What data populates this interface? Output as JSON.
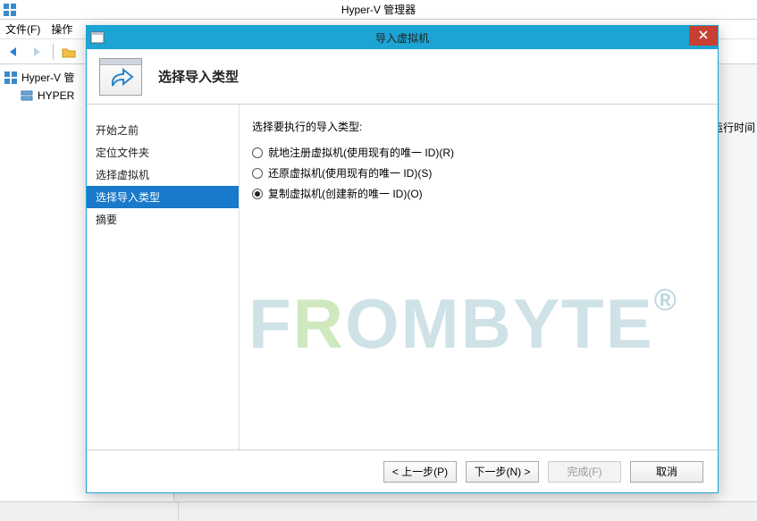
{
  "manager": {
    "title": "Hyper-V 管理器",
    "menu": {
      "file": "文件(F)",
      "action": "操作"
    },
    "tree": {
      "root": "Hyper-V 管",
      "child": "HYPER"
    },
    "right_label": "运行时间",
    "app_icon": "hyperv-icon"
  },
  "dialog": {
    "title": "导入虚拟机",
    "header": "选择导入类型",
    "nav": {
      "items": [
        "开始之前",
        "定位文件夹",
        "选择虚拟机",
        "选择导入类型",
        "摘要"
      ],
      "active_index": 3
    },
    "content": {
      "prompt": "选择要执行的导入类型:",
      "radios": [
        {
          "label": "就地注册虚拟机(使用现有的唯一 ID)(R)",
          "checked": false
        },
        {
          "label": "还原虚拟机(使用现有的唯一 ID)(S)",
          "checked": false
        },
        {
          "label": "复制虚拟机(创建新的唯一 ID)(O)",
          "checked": true
        }
      ]
    },
    "buttons": {
      "prev": "< 上一步(P)",
      "next": "下一步(N) >",
      "finish": "完成(F)",
      "cancel": "取消"
    },
    "close_icon": "close-icon",
    "wizard_icon": "arrow-share-icon"
  },
  "watermark": {
    "text_prefix": "F",
    "text_accent": "R",
    "text_mid1": "OM",
    "text_mid2": "B",
    "text_tail": "YTE",
    "reg": "®"
  }
}
